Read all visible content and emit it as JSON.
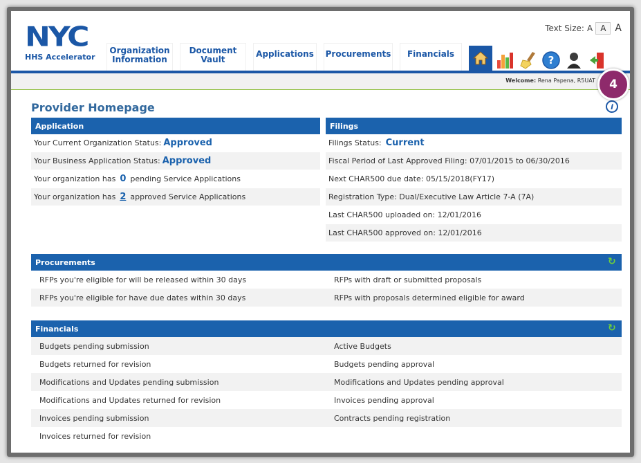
{
  "header": {
    "logo_text": "NYC",
    "logo_sub": "HHS Accelerator",
    "text_size_label": "Text Size:",
    "text_size_options": [
      "A",
      "A",
      "A"
    ],
    "nav": [
      {
        "label_line1": "Organization",
        "label_line2": "Information"
      },
      {
        "label_line1": "Document",
        "label_line2": "Vault"
      },
      {
        "label_line1": "Applications",
        "label_line2": ""
      },
      {
        "label_line1": "Procurements",
        "label_line2": ""
      },
      {
        "label_line1": "Financials",
        "label_line2": ""
      }
    ],
    "icons": [
      "home-icon",
      "chart-icon",
      "broom-icon",
      "help-icon",
      "user-icon",
      "logout-icon"
    ],
    "welcome_label": "Welcome:",
    "welcome_user": "Rena Papena, R5UAT"
  },
  "badge": "4",
  "page_title": "Provider Homepage",
  "application": {
    "title": "Application",
    "org_status_label": "Your Current Organization Status:",
    "org_status_value": "Approved",
    "biz_status_label": "Your Business Application Status:",
    "biz_status_value": "Approved",
    "pending_prefix": "Your organization has",
    "pending_count": "0",
    "pending_suffix": "pending Service Applications",
    "approved_prefix": "Your organization has",
    "approved_count": "2",
    "approved_suffix": "approved Service Applications"
  },
  "filings": {
    "title": "Filings",
    "status_label": "Filings Status:",
    "status_value": "Current",
    "rows": [
      "Fiscal Period of Last Approved Filing: 07/01/2015 to 06/30/2016",
      "Next CHAR500 due date: 05/15/2018(FY17)",
      "Registration Type: Dual/Executive Law Article 7-A (7A)",
      "Last CHAR500 uploaded on: 12/01/2016",
      "Last CHAR500 approved on: 12/01/2016"
    ]
  },
  "procurements": {
    "title": "Procurements",
    "left": [
      "RFPs you're eligible for will be released within 30 days",
      "RFPs you're eligible for have due dates within 30 days"
    ],
    "right": [
      "RFPs with draft or submitted proposals",
      "RFPs with proposals determined eligible for award"
    ]
  },
  "financials": {
    "title": "Financials",
    "left": [
      "Budgets pending submission",
      "Budgets returned for revision",
      "Modifications and Updates pending submission",
      "Modifications and Updates returned for revision",
      "Invoices pending submission",
      "Invoices returned for revision"
    ],
    "right": [
      "Active Budgets",
      "Budgets pending approval",
      "Modifications and Updates pending approval",
      "Invoices pending approval",
      "Contracts pending registration",
      ""
    ]
  },
  "colors": {
    "brand_blue": "#1b57a6",
    "panel_header": "#1b62ad",
    "badge": "#8e2a6b",
    "refresh_green": "#6fcf3a"
  }
}
